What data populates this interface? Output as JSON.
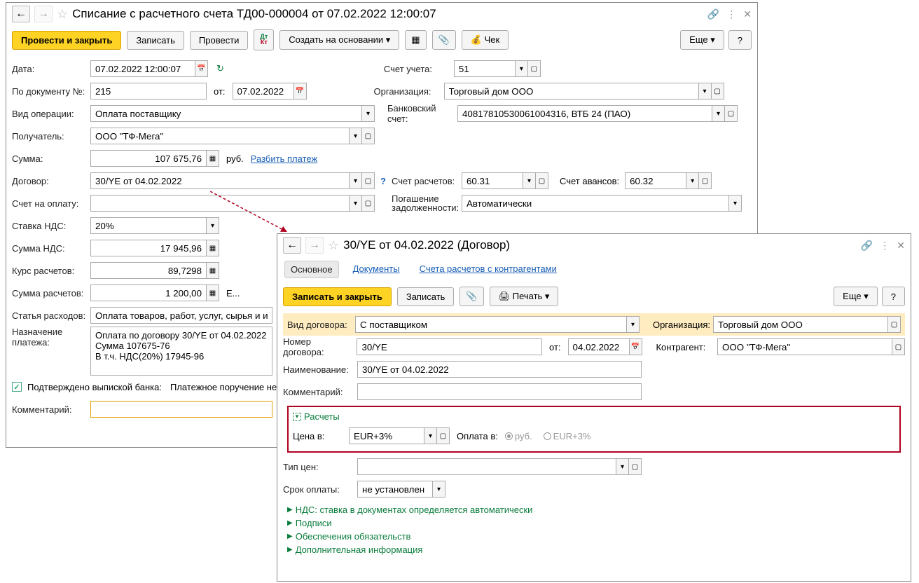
{
  "win1": {
    "title": "Списание с расчетного счета ТД00-000004 от 07.02.2022 12:00:07",
    "toolbar": {
      "post_close": "Провести и закрыть",
      "save": "Записать",
      "post": "Провести",
      "create_based": "Создать на основании",
      "check": "Чек",
      "more": "Еще",
      "help": "?"
    },
    "labels": {
      "date": "Дата:",
      "by_doc_no": "По документу №:",
      "from": "от:",
      "account": "Счет учета:",
      "org": "Организация:",
      "op_type": "Вид операции:",
      "bank_acc": "Банковский счет:",
      "recipient": "Получатель:",
      "amount": "Сумма:",
      "rub": "руб.",
      "split": "Разбить платеж",
      "contract": "Договор:",
      "settle_acc": "Счет расчетов:",
      "advance_acc": "Счет авансов:",
      "invoice": "Счет на оплату:",
      "debt": "Погашение задолженности:",
      "vat_rate": "Ставка НДС:",
      "vat_sum": "Сумма НДС:",
      "rate": "Курс расчетов:",
      "settle_sum": "Сумма расчетов:",
      "expense": "Статья расходов:",
      "purpose": "Назначение платежа:",
      "confirmed": "Подтверждено выпиской банка:",
      "pp_not": "Платежное поручение не",
      "comment": "Комментарий:",
      "ellipsis": "Е..."
    },
    "values": {
      "date": "07.02.2022 12:00:07",
      "doc_no": "215",
      "doc_date": "07.02.2022",
      "account": "51",
      "org": "Торговый дом ООО",
      "op_type": "Оплата поставщику",
      "bank_acc": "40817810530061004316, ВТБ 24 (ПАО)",
      "recipient": "ООО \"ТФ-Мега\"",
      "amount": "107 675,76",
      "contract": "30/YE от 04.02.2022",
      "settle_acc": "60.31",
      "advance_acc": "60.32",
      "debt": "Автоматически",
      "vat_rate": "20%",
      "vat_sum": "17 945,96",
      "rate": "89,7298",
      "settle_sum": "1 200,00",
      "expense": "Оплата товаров, работ, услуг, сырья и ины",
      "purpose": "Оплата по договору 30/YE от 04.02.2022\nСумма 107675-76\nВ т.ч. НДС(20%) 17945-96"
    }
  },
  "win2": {
    "title": "30/YE от 04.02.2022 (Договор)",
    "tabs": {
      "main": "Основное",
      "docs": "Документы",
      "accounts": "Счета расчетов с контрагентами"
    },
    "toolbar": {
      "save_close": "Записать и закрыть",
      "save": "Записать",
      "print": "Печать",
      "more": "Еще",
      "help": "?"
    },
    "labels": {
      "contract_type": "Вид договора:",
      "org": "Организация:",
      "contract_no": "Номер договора:",
      "from": "от:",
      "counterparty": "Контрагент:",
      "name": "Наименование:",
      "comment": "Комментарий:",
      "settlements": "Расчеты",
      "price_in": "Цена в:",
      "payment_in": "Оплата в:",
      "rub": "руб.",
      "eur3": "EUR+3%",
      "price_type": "Тип цен:",
      "pay_term": "Срок оплаты:",
      "nds": "НДС: ставка в документах определяется автоматически",
      "signs": "Подписи",
      "obligations": "Обеспечения обязательств",
      "additional": "Дополнительная информация"
    },
    "values": {
      "contract_type": "С поставщиком",
      "org": "Торговый дом ООО",
      "contract_no": "30/YE",
      "date": "04.02.2022",
      "counterparty": "ООО \"ТФ-Мега\"",
      "name": "30/YE от 04.02.2022",
      "price_in": "EUR+3%",
      "pay_term": "не установлен"
    }
  }
}
